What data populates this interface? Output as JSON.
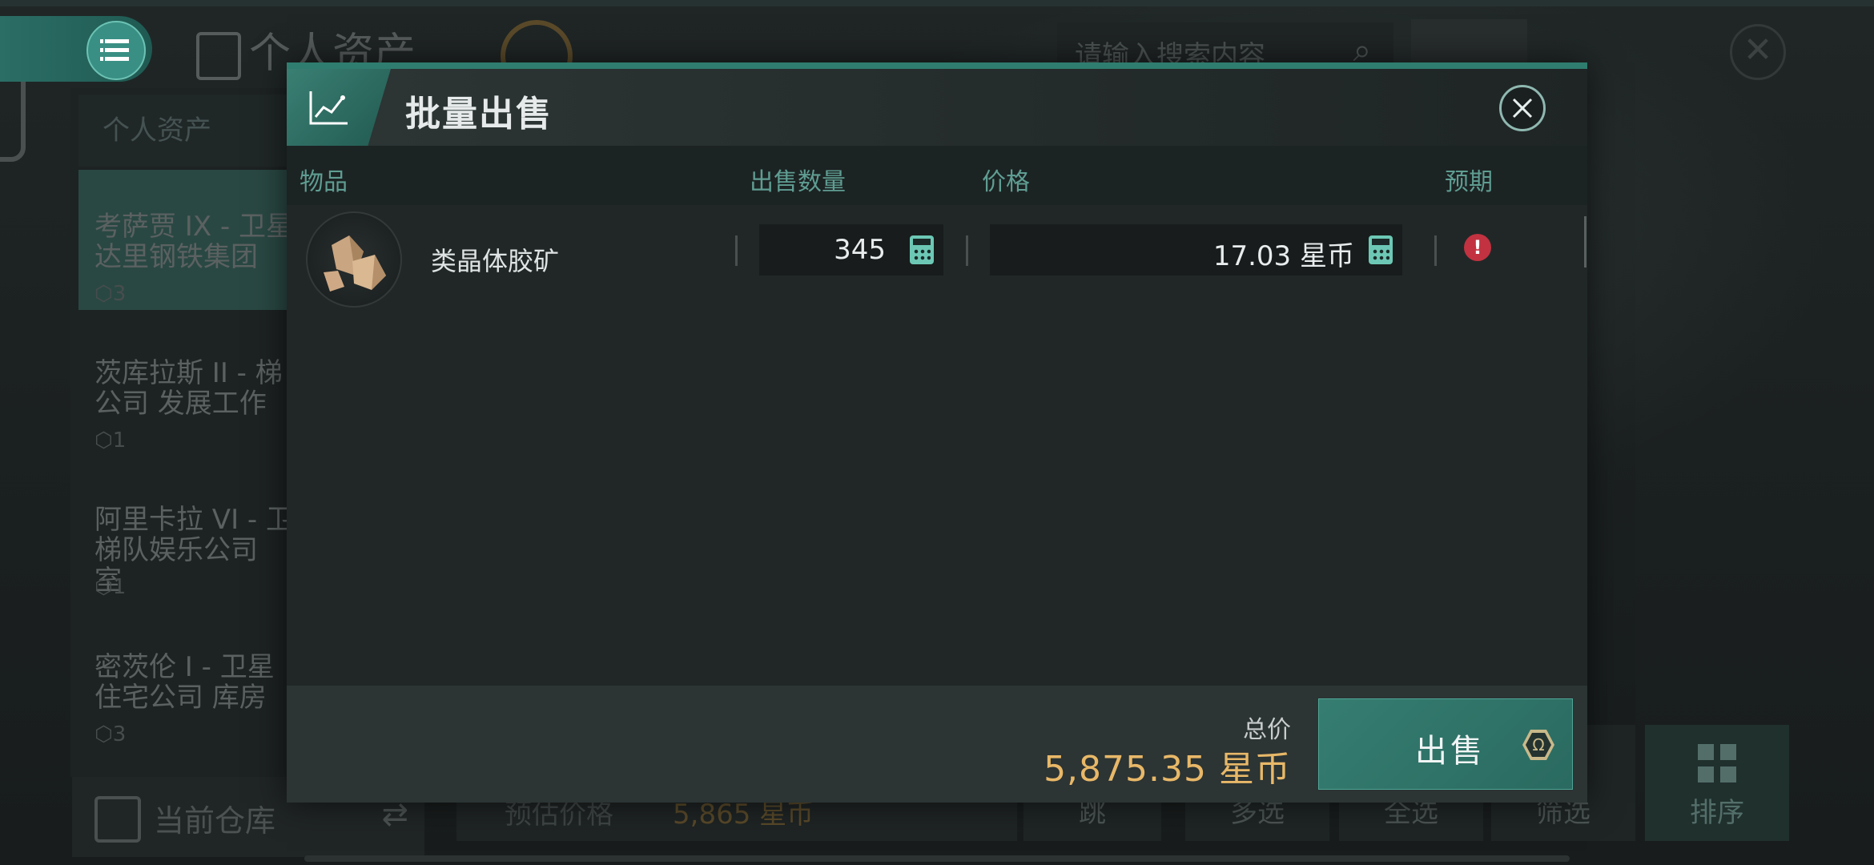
{
  "background": {
    "page_title": "个人资产",
    "search_placeholder": "请输入搜索内容",
    "sidebar_tab": "个人资产",
    "locations": [
      {
        "name": "考萨贾 IX - 卫星\n达里钢铁集团",
        "count": "3"
      },
      {
        "name": "茨库拉斯 II - 梯\n公司 发展工作",
        "count": "1"
      },
      {
        "name": "阿里卡拉 VI - 卫\n梯队娱乐公司\n室",
        "count": "1"
      },
      {
        "name": "密茨伦 I - 卫星\n住宅公司 库房",
        "count": "3"
      }
    ],
    "current_warehouse": "当前仓库",
    "estimate_label": "预估价格",
    "estimate_value": "5,865 星币",
    "jump_label": "跳",
    "buttons": {
      "multi": "多选",
      "all": "全选",
      "filter": "筛选",
      "sort": "排序"
    }
  },
  "modal": {
    "title": "批量出售",
    "columns": {
      "item": "物品",
      "qty": "出售数量",
      "price": "价格",
      "expect": "预期"
    },
    "rows": [
      {
        "name": "类晶体胶矿",
        "qty": "345",
        "price": "17.03 星币"
      }
    ],
    "footer": {
      "total_label": "总价",
      "total_value": "5,875.35 星币",
      "sell_label": "出售",
      "sell_icon": "Ω"
    }
  },
  "colors": {
    "accent": "#2f7d6f",
    "gold": "#e8b868",
    "warning": "#c23240"
  }
}
